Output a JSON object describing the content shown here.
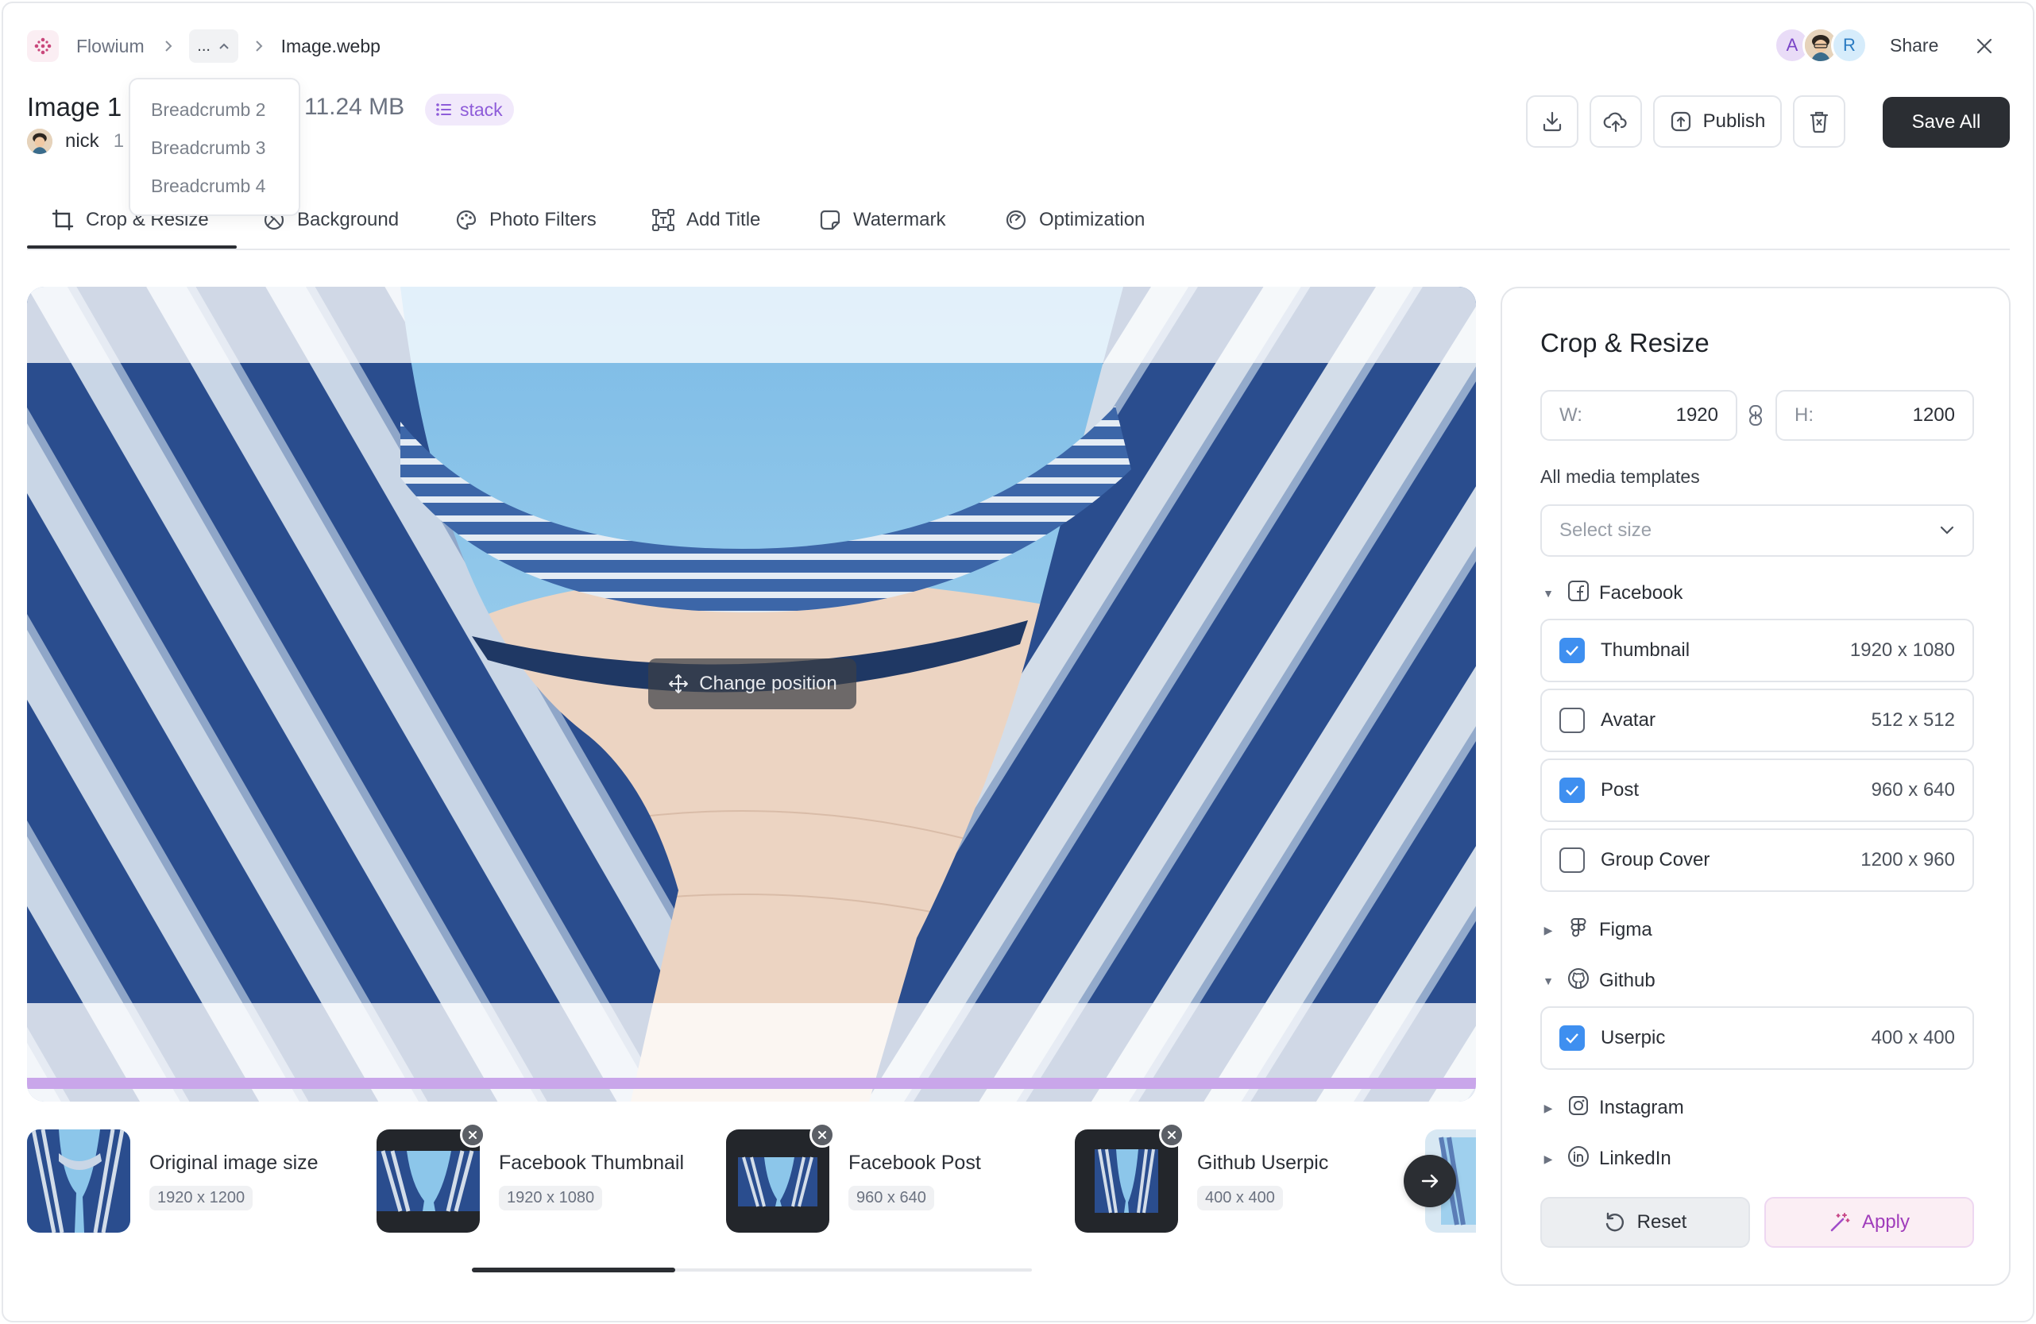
{
  "app": {
    "name": "Flowium",
    "breadcrumb_ellipsis": "...",
    "breadcrumb_current": "Image.webp",
    "breadcrumb_menu": [
      "Breadcrumb 2",
      "Breadcrumb 3",
      "Breadcrumb 4"
    ]
  },
  "header": {
    "title": "Image 1",
    "file_size": "11.24 MB",
    "tag": "stack",
    "owner": "nick",
    "owner_meta": "1 r",
    "avatars": [
      "A",
      "R"
    ],
    "share_label": "Share",
    "publish_label": "Publish",
    "save_all_label": "Save All"
  },
  "tabs": [
    {
      "label": "Crop & Resize",
      "icon": "crop-icon"
    },
    {
      "label": "Background",
      "icon": "background-icon"
    },
    {
      "label": "Photo Filters",
      "icon": "palette-icon"
    },
    {
      "label": "Add Title",
      "icon": "text-frame-icon"
    },
    {
      "label": "Watermark",
      "icon": "watermark-icon"
    },
    {
      "label": "Optimization",
      "icon": "gauge-icon"
    }
  ],
  "canvas": {
    "change_position_label": "Change position"
  },
  "thumbnails": [
    {
      "title": "Original image size",
      "dims": "1920 x 1200"
    },
    {
      "title": "Facebook Thumbnail",
      "dims": "1920 x 1080"
    },
    {
      "title": "Facebook Post",
      "dims": "960 x 640"
    },
    {
      "title": "Github Userpic",
      "dims": "400 x 400"
    }
  ],
  "panel": {
    "title": "Crop & Resize",
    "width_label": "W:",
    "width_value": "1920",
    "height_label": "H:",
    "height_value": "1200",
    "templates_label": "All media templates",
    "select_placeholder": "Select size",
    "groups": [
      {
        "name": "Facebook",
        "expanded": true,
        "items": [
          {
            "label": "Thumbnail",
            "dims": "1920 x 1080",
            "checked": true
          },
          {
            "label": "Avatar",
            "dims": "512 x 512",
            "checked": false
          },
          {
            "label": "Post",
            "dims": "960 x 640",
            "checked": true
          },
          {
            "label": "Group Cover",
            "dims": "1200 x 960",
            "checked": false
          }
        ]
      },
      {
        "name": "Figma",
        "expanded": false,
        "items": []
      },
      {
        "name": "Github",
        "expanded": true,
        "items": [
          {
            "label": "Userpic",
            "dims": "400 x 400",
            "checked": true
          }
        ]
      },
      {
        "name": "Instagram",
        "expanded": false,
        "items": []
      },
      {
        "name": "LinkedIn",
        "expanded": false,
        "items": []
      }
    ],
    "reset_label": "Reset",
    "apply_label": "Apply"
  },
  "colors": {
    "accent_purple": "#8e5cd9",
    "checkbox_blue": "#3e8ff0",
    "dark_button": "#2b2e33"
  }
}
